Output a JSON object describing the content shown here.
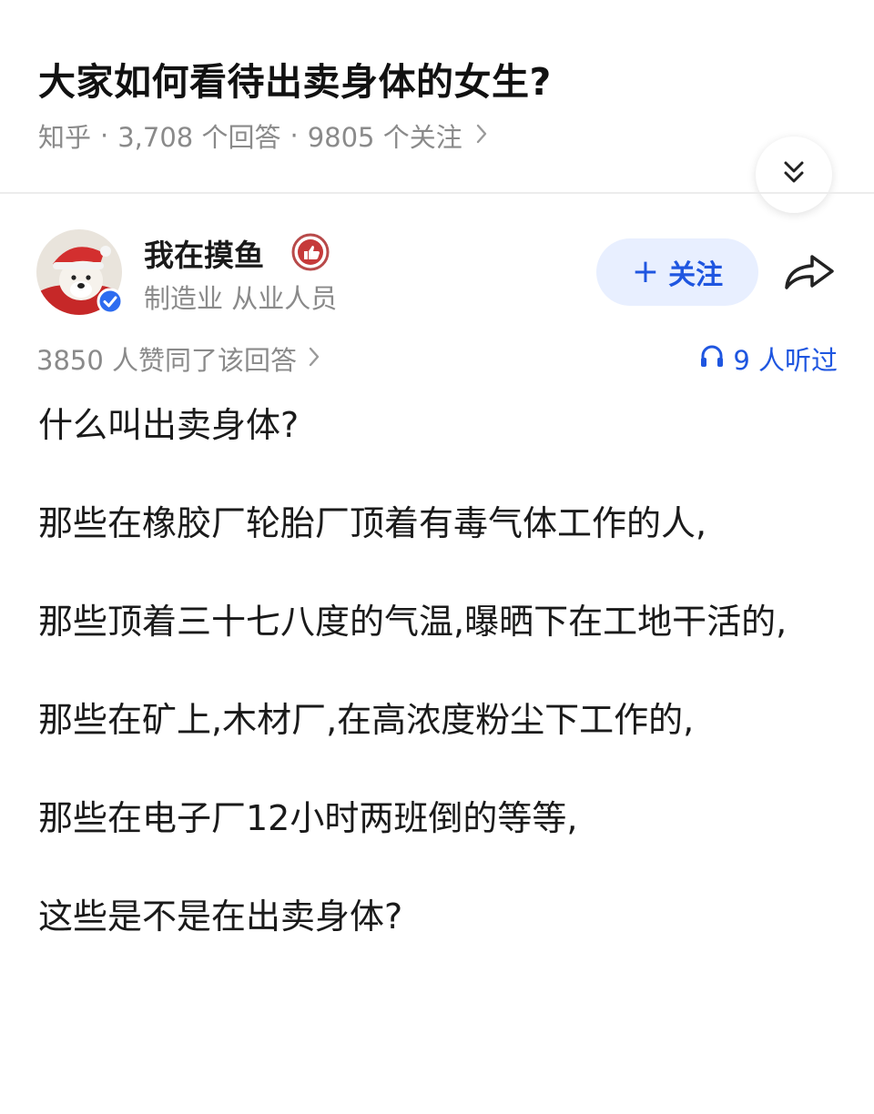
{
  "question": {
    "title": "大家如何看待出卖身体的女生?",
    "source": "知乎",
    "answers": "3,708 个回答",
    "followers": "9805 个关注",
    "separator": "·"
  },
  "author": {
    "name": "我在摸鱼",
    "description": "制造业 从业人员",
    "follow_label": "关注",
    "follow_plus": "+"
  },
  "stats": {
    "votes": "3850 人赞同了该回答",
    "listeners": "9 人听过"
  },
  "answer": {
    "paragraphs": [
      "什么叫出卖身体?",
      "那些在橡胶厂轮胎厂顶着有毒气体工作的人,",
      "那些顶着三十七八度的气温,曝晒下在工地干活的,",
      "那些在矿上,木材厂,在高浓度粉尘下工作的,",
      "那些在电子厂12小时两班倒的等等,",
      "这些是不是在出卖身体?"
    ]
  },
  "icons": {
    "collapse": "double-chevron-down-icon",
    "share": "share-arrow-icon",
    "headphones": "headphones-icon",
    "badge": "thumb-badge-icon",
    "verified": "verified-check-icon"
  },
  "colors": {
    "accent": "#1f56e0",
    "follow_bg": "#e8efff",
    "meta_gray": "#8a8a8a",
    "badge_red": "#c63a3a"
  }
}
